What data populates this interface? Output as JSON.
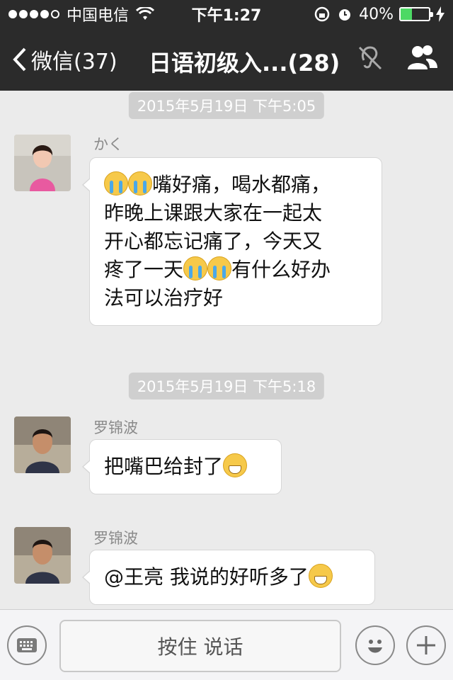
{
  "status_bar": {
    "carrier": "中国电信",
    "time": "下午1:27",
    "battery": "40%",
    "battery_level": 0.4
  },
  "nav": {
    "back_label": "微信(37)",
    "title": "日语初级入...(28)",
    "icons": [
      "chevron-left-icon",
      "earpiece-muted-icon",
      "group-members-icon"
    ]
  },
  "messages": [
    {
      "type": "timestamp",
      "text": "2015年5月19日  下午5:05"
    },
    {
      "type": "message",
      "sender": "かく",
      "text_parts": [
        "嘴好痛，喝水都痛，",
        "昨晚上课跟大家在一起太",
        "开心都忘记痛了，今天又",
        "疼了一天",
        "有什么好办",
        "法可以治疗好"
      ]
    },
    {
      "type": "timestamp",
      "text": "2015年5月19日  下午5:18"
    },
    {
      "type": "message",
      "sender": "罗锦波",
      "text": "把嘴巴给封了"
    },
    {
      "type": "message",
      "sender": "罗锦波",
      "text": "@王亮 我说的好听多了"
    }
  ],
  "input_bar": {
    "hold_to_talk": "按住 说话",
    "icons": [
      "keyboard-icon",
      "emoji-icon",
      "plus-icon"
    ]
  },
  "colors": {
    "bar_bg": "#2b2b2b",
    "chat_bg": "#ebebeb",
    "battery_green": "#4cd964"
  }
}
